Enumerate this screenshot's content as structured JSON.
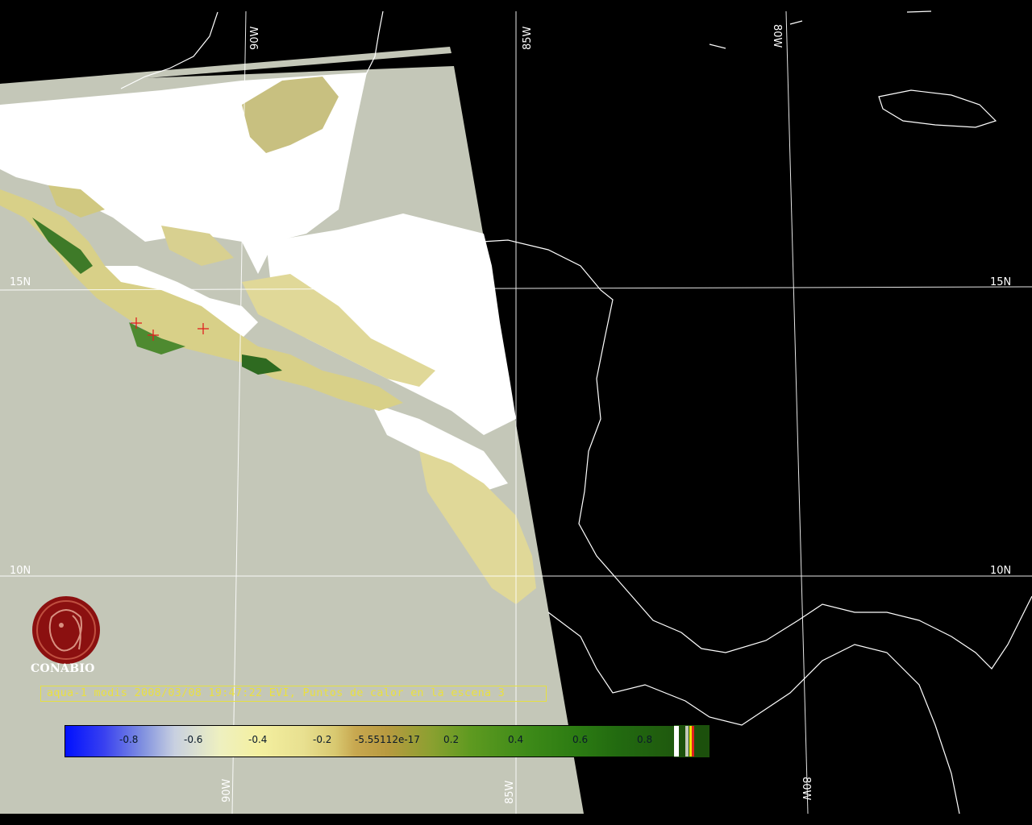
{
  "map": {
    "grid_labels": {
      "lon_90w": "90W",
      "lon_85w": "85W",
      "lon_80w": "80W",
      "lat_15n": "15N",
      "lat_10n": "10N"
    },
    "colors": {
      "ocean_scene": "#c4c7b8",
      "cloud": "#ffffff",
      "background": "#000000",
      "coastline": "#ffffff",
      "hotspot_marker": "#e02020"
    },
    "hotspot_count_marks": 3
  },
  "logo": {
    "icon": "conabio-logo-icon",
    "name": "CONABIO",
    "color": "#8b1010"
  },
  "caption": {
    "text": "aqua-1 modis 2008/03/08 19:47:22 EVI, Puntos de calor en la escena 3"
  },
  "colorbar": {
    "ticks": [
      "-0.8",
      "-0.6",
      "-0.4",
      "-0.2",
      "-5.55112e-17",
      "0.2",
      "0.4",
      "0.6",
      "0.8"
    ],
    "range": [
      -1,
      1
    ]
  }
}
